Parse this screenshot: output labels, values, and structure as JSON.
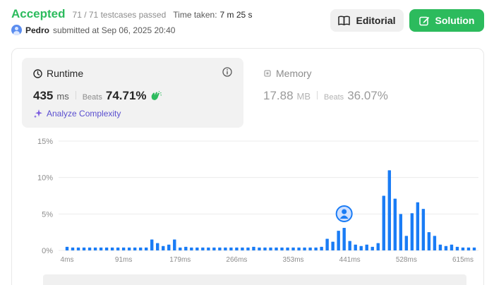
{
  "status": {
    "label": "Accepted",
    "testcases": "71 / 71 testcases passed",
    "time_taken_label": "Time taken:",
    "time_taken_value": "7 m 25 s"
  },
  "submission": {
    "user": "Pedro",
    "text": "submitted at Sep 06, 2025 20:40"
  },
  "buttons": {
    "editorial": "Editorial",
    "solution": "Solution"
  },
  "runtime": {
    "title": "Runtime",
    "value": "435",
    "unit": "ms",
    "beats_label": "Beats",
    "beats_value": "74.71%",
    "analyze_label": "Analyze Complexity"
  },
  "memory": {
    "title": "Memory",
    "value": "17.88",
    "unit": "MB",
    "beats_label": "Beats",
    "beats_value": "36.07%"
  },
  "colors": {
    "accent_green": "#2cbb5d",
    "bar_blue": "#1a7cf5",
    "analyze_purple": "#5a4fcf"
  },
  "chart_data": {
    "type": "bar",
    "ylim": [
      0,
      15
    ],
    "y_ticks": [
      "0%",
      "5%",
      "10%",
      "15%"
    ],
    "y_tick_values": [
      0,
      5,
      10,
      15
    ],
    "x_tick_labels": [
      "4ms",
      "91ms",
      "179ms",
      "266ms",
      "353ms",
      "441ms",
      "528ms",
      "615ms"
    ],
    "x_tick_indices": [
      0,
      10,
      20,
      30,
      40,
      50,
      60,
      70
    ],
    "highlight_index": 49,
    "values": [
      0.5,
      0.4,
      0.4,
      0.4,
      0.4,
      0.4,
      0.4,
      0.4,
      0.4,
      0.4,
      0.4,
      0.4,
      0.4,
      0.4,
      0.4,
      1.5,
      1.0,
      0.6,
      0.8,
      1.5,
      0.4,
      0.5,
      0.4,
      0.4,
      0.4,
      0.4,
      0.4,
      0.4,
      0.4,
      0.4,
      0.4,
      0.4,
      0.4,
      0.5,
      0.4,
      0.4,
      0.4,
      0.4,
      0.4,
      0.4,
      0.4,
      0.4,
      0.4,
      0.4,
      0.4,
      0.5,
      1.6,
      1.2,
      2.7,
      3.1,
      1.3,
      0.8,
      0.6,
      0.8,
      0.5,
      1.0,
      7.5,
      11.0,
      7.1,
      5.0,
      2.0,
      5.1,
      6.6,
      5.7,
      2.5,
      2.0,
      0.8,
      0.6,
      0.8,
      0.5,
      0.4,
      0.4,
      0.4
    ]
  }
}
